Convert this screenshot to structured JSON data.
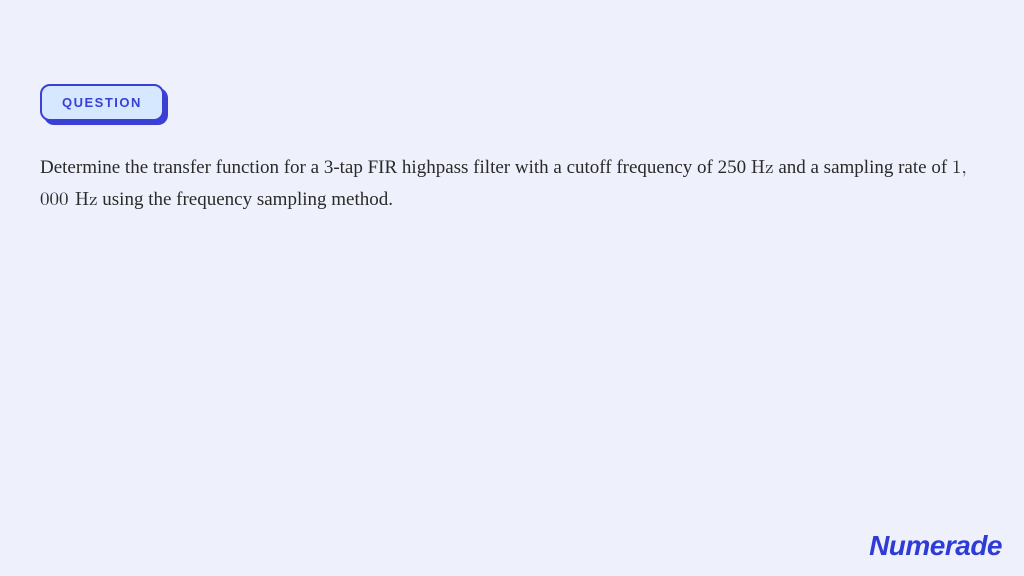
{
  "badge": {
    "label": "QUESTION"
  },
  "question": {
    "prefix": "Determine the transfer function for a 3-tap FIR highpass filter with a cutoff frequency of 250 ",
    "hz1": "Hz",
    "mid": " and a sampling rate of ",
    "rate": "1, 000 ",
    "hz2": "Hz",
    "suffix": " using the frequency sampling method."
  },
  "brand": "Numerade"
}
